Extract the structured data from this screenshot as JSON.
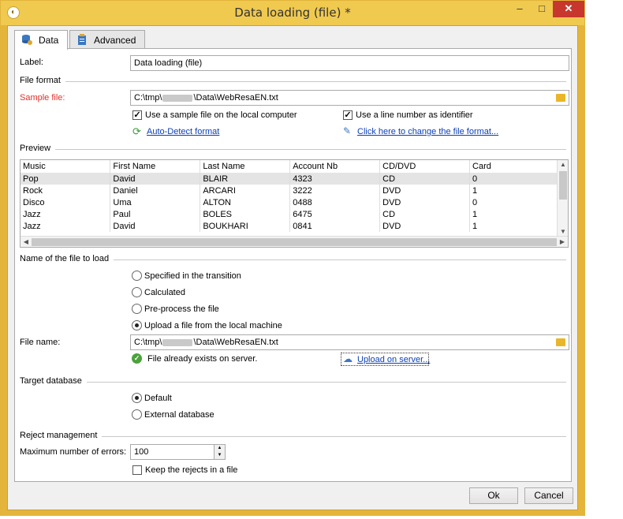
{
  "window": {
    "title": "Data loading (file) *",
    "minimize": "–",
    "maximize": "□",
    "close": "✕"
  },
  "tabs": [
    {
      "label": "Data",
      "icon": "database-icon"
    },
    {
      "label": "Advanced",
      "icon": "clipboard-icon"
    }
  ],
  "label_field": {
    "label": "Label:",
    "value": "Data loading (file)"
  },
  "file_format": {
    "section": "File format",
    "sample_label": "Sample file:",
    "sample_prefix": "C:\\tmp\\",
    "sample_suffix": "\\Data\\WebResaEN.txt",
    "use_sample": "Use a sample file on the local computer",
    "use_line_number": "Use a line number as identifier",
    "auto_detect": "Auto-Detect format",
    "change_format": "Click here to change the file format..."
  },
  "preview": {
    "section": "Preview",
    "columns": [
      "Music",
      "First Name",
      "Last Name",
      "Account Nb",
      "CD/DVD",
      "Card"
    ],
    "rows": [
      [
        "Pop",
        "David",
        "BLAIR",
        "4323",
        "CD",
        "0"
      ],
      [
        "Rock",
        "Daniel",
        "ARCARI",
        "3222",
        "DVD",
        "1"
      ],
      [
        "Disco",
        "Uma",
        "ALTON",
        "0488",
        "DVD",
        "0"
      ],
      [
        "Jazz",
        "Paul",
        "BOLES",
        "6475",
        "CD",
        "1"
      ],
      [
        "Jazz",
        "David",
        "BOUKHARI",
        "0841",
        "DVD",
        "1"
      ]
    ]
  },
  "file_to_load": {
    "section": "Name of the file to load",
    "options": [
      "Specified in the transition",
      "Calculated",
      "Pre-process the file",
      "Upload a file from the local machine"
    ],
    "selected": 3,
    "file_name_label": "File name:",
    "file_prefix": "C:\\tmp\\",
    "file_suffix": "\\Data\\WebResaEN.txt",
    "exists_msg": "File already exists on server.",
    "upload_link": "Upload on server..."
  },
  "target_db": {
    "section": "Target database",
    "options": [
      "Default",
      "External database"
    ],
    "selected": 0
  },
  "reject": {
    "section": "Reject management",
    "max_errors_label": "Maximum number of errors:",
    "max_errors_value": "100",
    "keep_rejects": "Keep the rejects in a file"
  },
  "buttons": {
    "ok": "Ok",
    "cancel": "Cancel"
  },
  "colors": {
    "frame": "#f0c94f",
    "required_label": "#e0322c",
    "link": "#0b3fb5",
    "close_button": "#c7372d"
  }
}
